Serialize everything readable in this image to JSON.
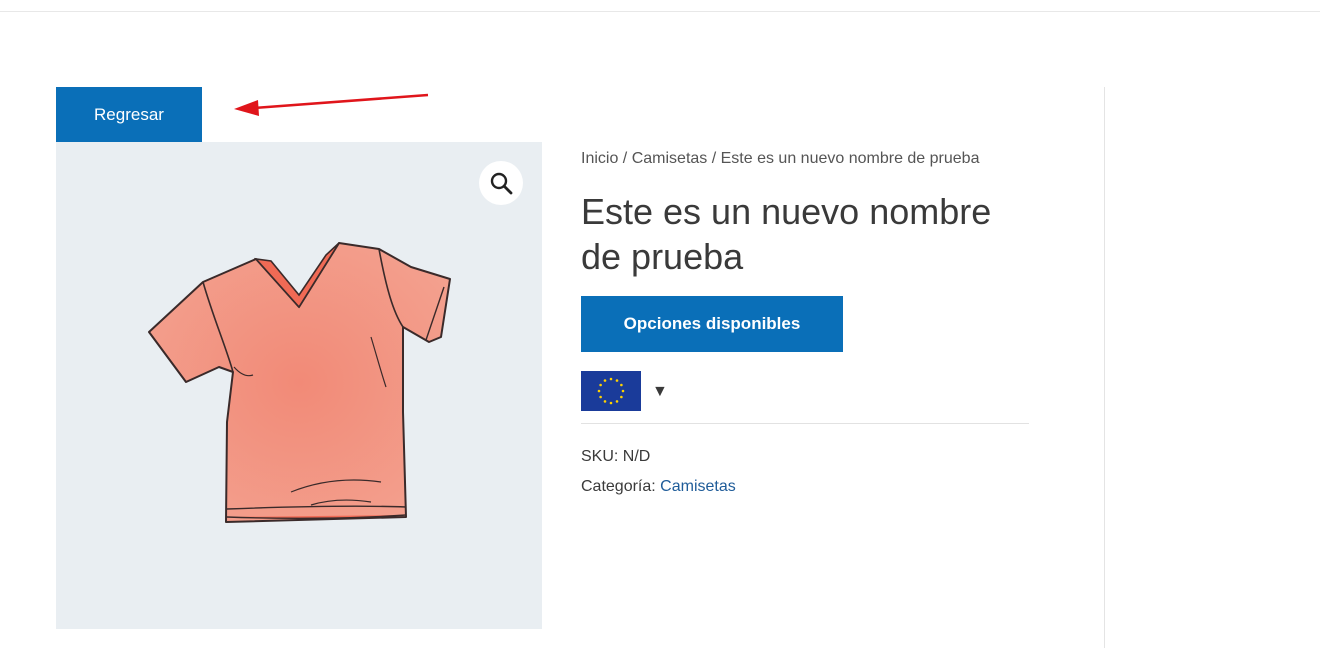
{
  "back_button": {
    "label": "Regresar"
  },
  "breadcrumb": {
    "home": "Inicio",
    "separator_1": " / ",
    "category": "Camisetas",
    "separator_2": " / ",
    "current": "Este es un nuevo nombre de prueba"
  },
  "product": {
    "title": "Este es un nuevo nombre de prueba",
    "options_button": "Opciones disponibles",
    "language_flag": "eu-flag-icon",
    "sku_label": "SKU:",
    "sku_value": "N/D",
    "category_label": "Categoría:",
    "category_value": "Camisetas"
  },
  "icons": {
    "zoom": "magnifier-icon",
    "caret": "▼"
  },
  "colors": {
    "accent": "#0a6fb8",
    "link": "#1f5c99",
    "image_bg": "#e9eef2",
    "shirt": "#f08470",
    "annotation": "#e0151b"
  }
}
